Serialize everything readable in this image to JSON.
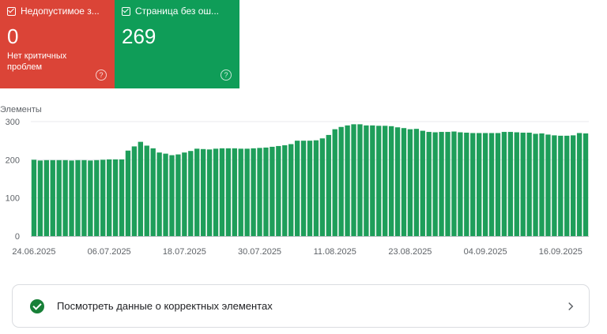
{
  "cards": {
    "invalid": {
      "label": "Недопустимое з...",
      "count": "0",
      "subtitle": "Нет критичных проблем",
      "help": "?"
    },
    "valid": {
      "label": "Страница без ош...",
      "count": "269",
      "help": "?"
    }
  },
  "chart_data": {
    "type": "bar",
    "title": "",
    "ylabel": "Элементы",
    "xlabel": "",
    "ylim": [
      0,
      300
    ],
    "yticks": [
      "0",
      "100",
      "200",
      "300"
    ],
    "xtick_labels": [
      "24.06.2025",
      "06.07.2025",
      "18.07.2025",
      "30.07.2025",
      "11.08.2025",
      "23.08.2025",
      "04.09.2025",
      "16.09.2025"
    ],
    "xtick_every": 12,
    "grid": true,
    "color": "#1e9e5a",
    "series": [
      {
        "values": [
          200,
          198,
          199,
          199,
          199,
          199,
          198,
          199,
          199,
          198,
          199,
          200,
          201,
          201,
          201,
          224,
          235,
          247,
          237,
          230,
          219,
          216,
          212,
          214,
          219,
          223,
          229,
          228,
          227,
          229,
          230,
          230,
          230,
          229,
          229,
          230,
          231,
          232,
          234,
          236,
          238,
          241,
          250,
          250,
          250,
          251,
          256,
          265,
          280,
          286,
          290,
          293,
          293,
          290,
          290,
          289,
          289,
          288,
          285,
          283,
          280,
          281,
          276,
          273,
          272,
          273,
          273,
          274,
          272,
          271,
          270,
          270,
          270,
          270,
          270,
          273,
          273,
          272,
          271,
          271,
          268,
          269,
          266,
          264,
          263,
          263,
          264,
          270,
          269
        ]
      }
    ]
  },
  "footer_link": {
    "label": "Посмотреть данные о корректных элементах"
  }
}
